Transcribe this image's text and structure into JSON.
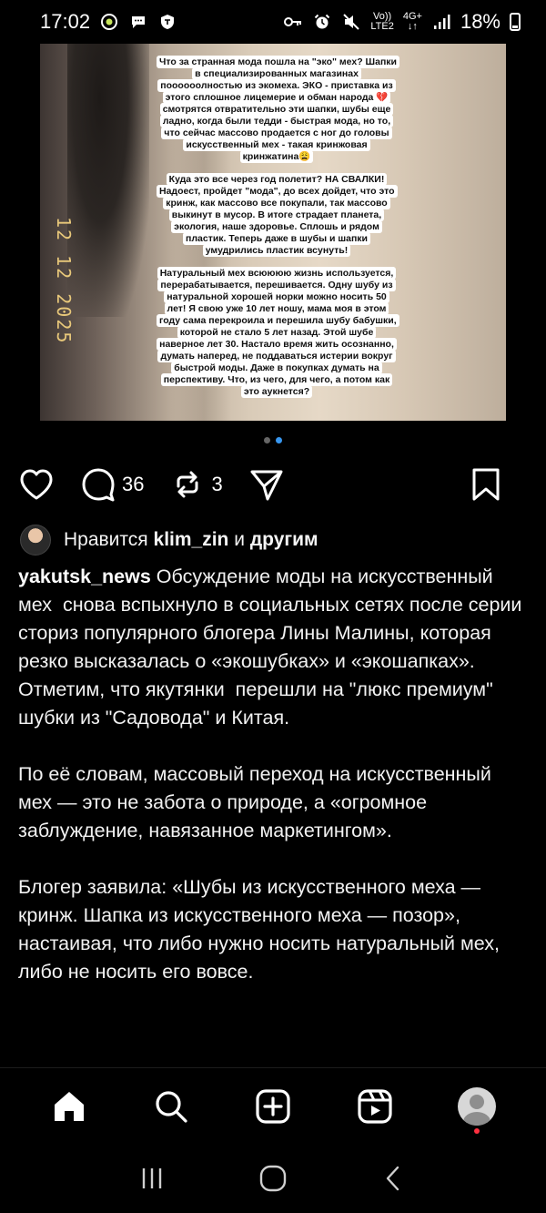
{
  "status_bar": {
    "time": "17:02",
    "network_top": "Vo))",
    "network_bottom": "LTE2",
    "data_top": "4G+",
    "data_bottom": "↓↑",
    "battery": "18%"
  },
  "post": {
    "image": {
      "date_stamp": "12 12 2025",
      "story_blocks": [
        "Что за странная мода пошла на \"эко\" мех? Шапки в специализированных магазинах поооооолностью из экомеха. ЭКО - приставка из этого сплошное лицемерие и обман народа 💔 смотрятся отвратительно эти шапки, шубы еще ладно, когда были тедди - быстрая мода, но то, что сейчас массово продается с ног до головы искусственный мех - такая кринжовая кринжатина😩",
        "Куда это все через год полетит? НА СВАЛКИ! Надоест, пройдет \"мода\", до всех дойдет, что это кринж, как массово все покупали, так массово выкинут в мусор. В итоге страдает планета, экология, наше здоровье. Сплошь и рядом пластик. Теперь даже в шубы и шапки умудрились пластик всунуть!",
        "Натуральный мех всюююю жизнь используется, перерабатывается, перешивается. Одну шубу из натуральной хорошей норки можно носить 50 лет! Я свою уже 10 лет ношу, мама моя в этом году сама перекроила и перешила шубу бабушки, которой не стало 5 лет назад. Этой шубе наверное лет 30. Настало время жить осознанно, думать наперед, не поддаваться истерии вокруг быстрой моды. Даже в покупках думать на перспективу. Что, из чего, для чего, а потом как это аукнется?"
      ]
    },
    "carousel": {
      "total": 2,
      "active": 2
    },
    "actions": {
      "comments_count": "36",
      "reposts_count": "3"
    },
    "likes": {
      "prefix": "Нравится",
      "user": "klim_zin",
      "joiner": "и",
      "suffix": "другим"
    },
    "caption": {
      "username": "yakutsk_news",
      "paragraphs": [
        "Обсуждение моды на искусственный мех  снова вспыхнуло в социальных сетях после серии сториз популярного блогера Лины Малины, которая резко высказалась о «экошубках» и «экошапках». Отметим, что якутянки  перешли на \"люкс премиум\" шубки из \"Садовода\" и Китая.",
        "По её словам, массовый переход на искусственный мех — это не забота о природе, а «огромное заблуждение, навязанное маркетингом».",
        "Блогер заявила: «Шубы из искусственного меха — кринж. Шапка из искусственного меха — позор», настаивая, что либо нужно носить натуральный мех, либо не носить его вовсе."
      ]
    }
  },
  "bottom_nav": {
    "items": [
      "home-icon",
      "search-icon",
      "create-icon",
      "reels-icon",
      "profile-avatar"
    ],
    "active": "home-icon"
  },
  "system_nav": [
    "recent-apps-icon",
    "home-circle-icon",
    "back-icon"
  ],
  "colors": {
    "background": "#000000",
    "accent_dot": "#3897f0",
    "notification": "#ff3040"
  }
}
